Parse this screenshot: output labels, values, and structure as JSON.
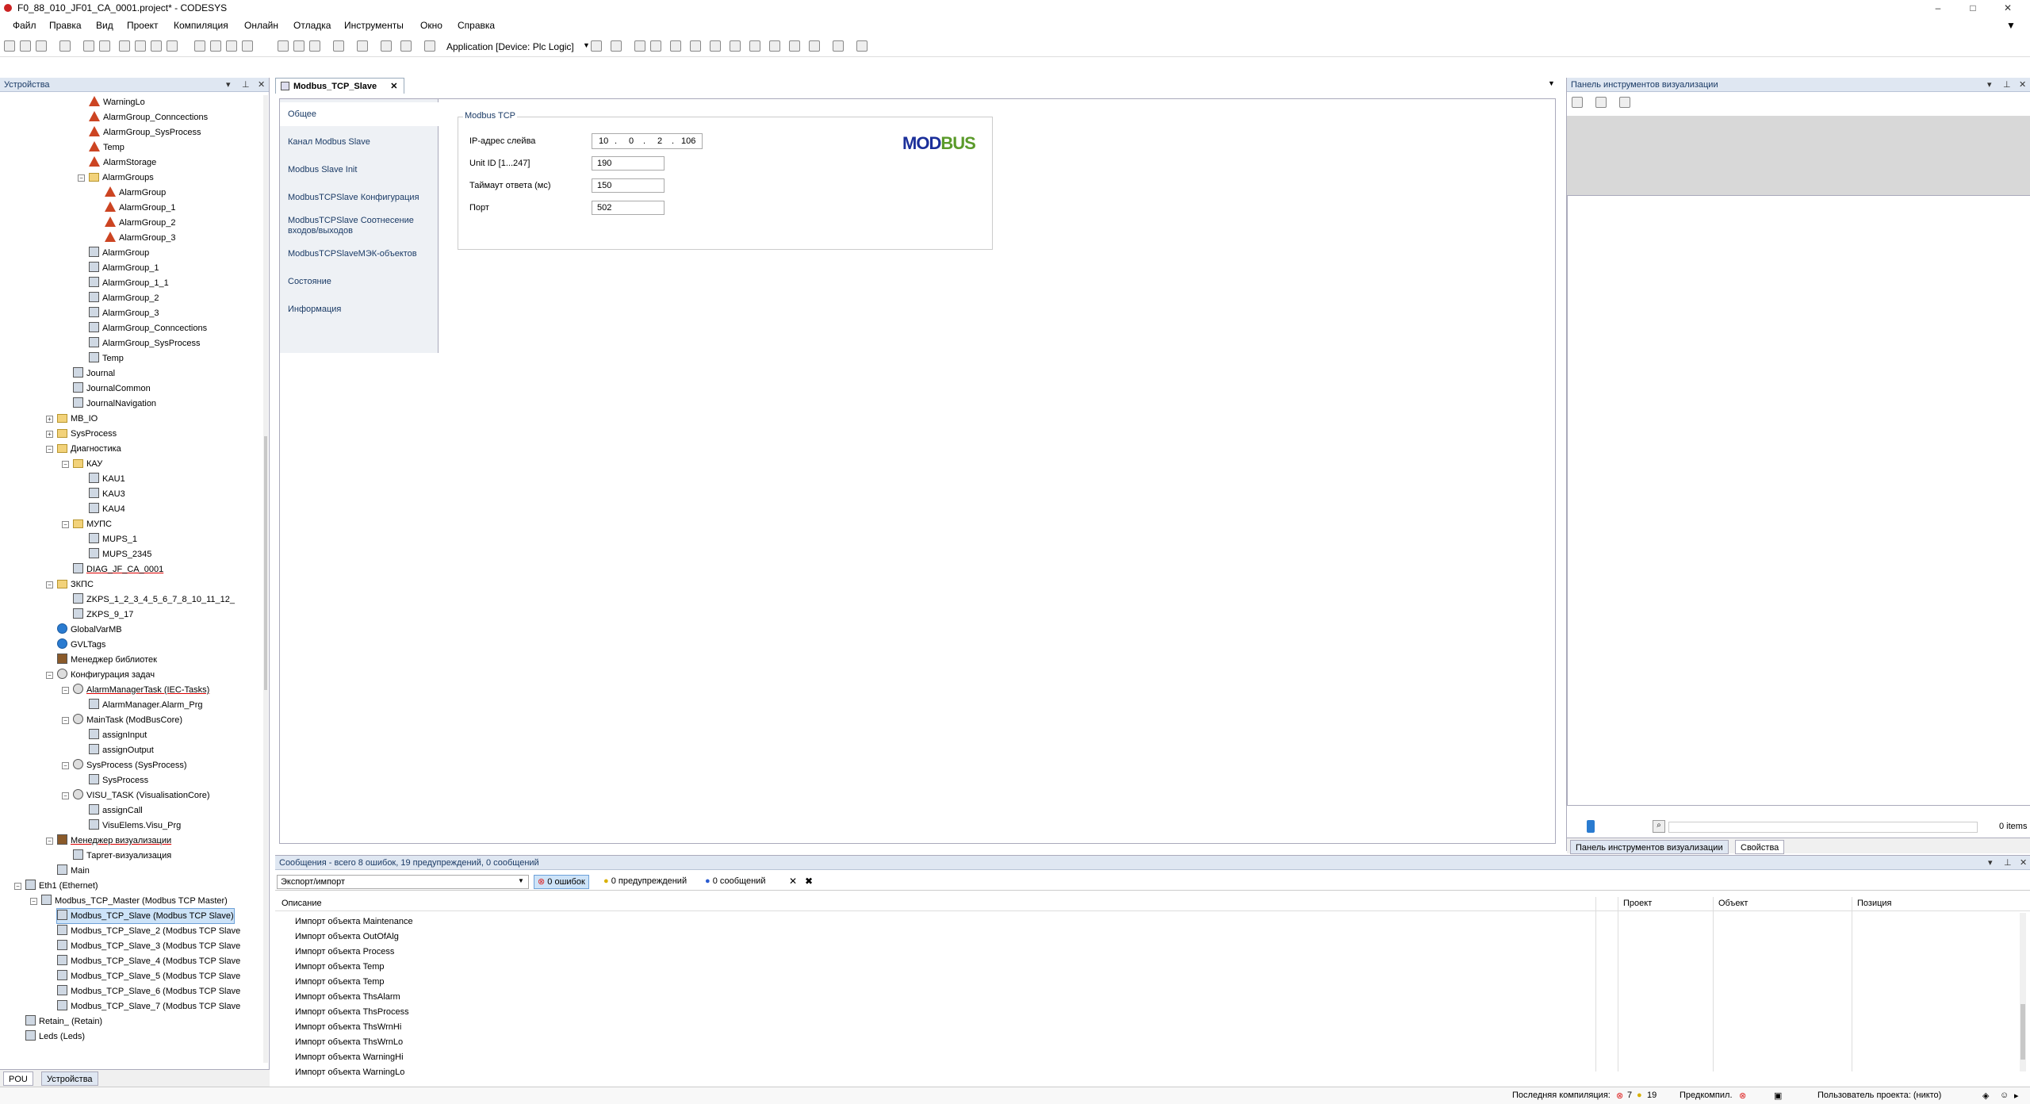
{
  "window": {
    "title": "F0_88_010_JF01_CA_0001.project* - CODESYS",
    "minimize": "–",
    "maximize": "□",
    "close": "✕"
  },
  "menu": [
    "Файл",
    "Правка",
    "Вид",
    "Проект",
    "Компиляция",
    "Онлайн",
    "Отладка",
    "Инструменты",
    "Окно",
    "Справка"
  ],
  "toolbar": {
    "application_label": "Application [Device: Plc Logic]"
  },
  "devices_panel": {
    "title": "Устройства",
    "tree": [
      {
        "label": "WarningLo",
        "depth": 6,
        "icon": "alarm"
      },
      {
        "label": "AlarmGroup_Conncections",
        "depth": 6,
        "icon": "alarm"
      },
      {
        "label": "AlarmGroup_SysProcess",
        "depth": 6,
        "icon": "alarm"
      },
      {
        "label": "Temp",
        "depth": 6,
        "icon": "alarm"
      },
      {
        "label": "AlarmStorage",
        "depth": 6,
        "icon": "alarm"
      },
      {
        "label": "AlarmGroups",
        "depth": 6,
        "icon": "folder",
        "expander": "−"
      },
      {
        "label": "AlarmGroup",
        "depth": 7,
        "icon": "alarm"
      },
      {
        "label": "AlarmGroup_1",
        "depth": 7,
        "icon": "alarm"
      },
      {
        "label": "AlarmGroup_2",
        "depth": 7,
        "icon": "alarm"
      },
      {
        "label": "AlarmGroup_3",
        "depth": 7,
        "icon": "alarm"
      },
      {
        "label": "AlarmGroup",
        "depth": 6,
        "icon": "dev"
      },
      {
        "label": "AlarmGroup_1",
        "depth": 6,
        "icon": "dev"
      },
      {
        "label": "AlarmGroup_1_1",
        "depth": 6,
        "icon": "dev"
      },
      {
        "label": "AlarmGroup_2",
        "depth": 6,
        "icon": "dev"
      },
      {
        "label": "AlarmGroup_3",
        "depth": 6,
        "icon": "dev"
      },
      {
        "label": "AlarmGroup_Conncections",
        "depth": 6,
        "icon": "dev"
      },
      {
        "label": "AlarmGroup_SysProcess",
        "depth": 6,
        "icon": "dev"
      },
      {
        "label": "Temp",
        "depth": 6,
        "icon": "dev"
      },
      {
        "label": "Journal",
        "depth": 5,
        "icon": "dev"
      },
      {
        "label": "JournalCommon",
        "depth": 5,
        "icon": "dev"
      },
      {
        "label": "JournalNavigation",
        "depth": 5,
        "icon": "dev"
      },
      {
        "label": "MB_IO",
        "depth": 4,
        "icon": "folder",
        "expander": "+"
      },
      {
        "label": "SysProcess",
        "depth": 4,
        "icon": "folder",
        "expander": "+"
      },
      {
        "label": "Диагностика",
        "depth": 4,
        "icon": "folder",
        "expander": "−"
      },
      {
        "label": "КАУ",
        "depth": 5,
        "icon": "folder",
        "expander": "−"
      },
      {
        "label": "KAU1",
        "depth": 6,
        "icon": "dev"
      },
      {
        "label": "KAU3",
        "depth": 6,
        "icon": "dev"
      },
      {
        "label": "KAU4",
        "depth": 6,
        "icon": "dev"
      },
      {
        "label": "МУПС",
        "depth": 5,
        "icon": "folder",
        "expander": "−"
      },
      {
        "label": "MUPS_1",
        "depth": 6,
        "icon": "dev"
      },
      {
        "label": "MUPS_2345",
        "depth": 6,
        "icon": "dev"
      },
      {
        "label": "DIAG_JF_CA_0001",
        "depth": 5,
        "icon": "dev",
        "underline": true
      },
      {
        "label": "ЗКПС",
        "depth": 4,
        "icon": "folder",
        "expander": "−"
      },
      {
        "label": "ZKPS_1_2_3_4_5_6_7_8_10_11_12_",
        "depth": 5,
        "icon": "dev"
      },
      {
        "label": "ZKPS_9_17",
        "depth": 5,
        "icon": "dev"
      },
      {
        "label": "GlobalVarMB",
        "depth": 4,
        "icon": "globe"
      },
      {
        "label": "GVLTags",
        "depth": 4,
        "icon": "globe"
      },
      {
        "label": "Менеджер библиотек",
        "depth": 4,
        "icon": "lib"
      },
      {
        "label": "Конфигурация задач",
        "depth": 4,
        "icon": "gear",
        "expander": "−"
      },
      {
        "label": "AlarmManagerTask (IEC-Tasks)",
        "depth": 5,
        "icon": "gear",
        "expander": "−",
        "underline": true
      },
      {
        "label": "AlarmManager.Alarm_Prg",
        "depth": 6,
        "icon": "dev"
      },
      {
        "label": "MainTask (ModBusCore)",
        "depth": 5,
        "icon": "gear",
        "expander": "−"
      },
      {
        "label": "assignInput",
        "depth": 6,
        "icon": "dev"
      },
      {
        "label": "assignOutput",
        "depth": 6,
        "icon": "dev"
      },
      {
        "label": "SysProcess (SysProcess)",
        "depth": 5,
        "icon": "gear",
        "expander": "−"
      },
      {
        "label": "SysProcess",
        "depth": 6,
        "icon": "dev"
      },
      {
        "label": "VISU_TASK (VisualisationCore)",
        "depth": 5,
        "icon": "gear",
        "expander": "−"
      },
      {
        "label": "assignCall",
        "depth": 6,
        "icon": "dev"
      },
      {
        "label": "VisuElems.Visu_Prg",
        "depth": 6,
        "icon": "dev"
      },
      {
        "label": "Менеджер визуализации",
        "depth": 4,
        "icon": "lib",
        "expander": "−",
        "underline": true
      },
      {
        "label": "Таргет-визуализация",
        "depth": 5,
        "icon": "dev"
      },
      {
        "label": "Main",
        "depth": 4,
        "icon": "dev"
      },
      {
        "label": "Eth1 (Ethernet)",
        "depth": 2,
        "icon": "dev",
        "expander": "−"
      },
      {
        "label": "Modbus_TCP_Master (Modbus TCP Master)",
        "depth": 3,
        "icon": "dev",
        "expander": "−"
      },
      {
        "label": "Modbus_TCP_Slave (Modbus TCP Slave)",
        "depth": 4,
        "icon": "dev",
        "selected": true
      },
      {
        "label": "Modbus_TCP_Slave_2 (Modbus TCP Slave",
        "depth": 4,
        "icon": "dev"
      },
      {
        "label": "Modbus_TCP_Slave_3 (Modbus TCP Slave",
        "depth": 4,
        "icon": "dev"
      },
      {
        "label": "Modbus_TCP_Slave_4 (Modbus TCP Slave",
        "depth": 4,
        "icon": "dev"
      },
      {
        "label": "Modbus_TCP_Slave_5 (Modbus TCP Slave",
        "depth": 4,
        "icon": "dev"
      },
      {
        "label": "Modbus_TCP_Slave_6 (Modbus TCP Slave",
        "depth": 4,
        "icon": "dev"
      },
      {
        "label": "Modbus_TCP_Slave_7 (Modbus TCP Slave",
        "depth": 4,
        "icon": "dev"
      },
      {
        "label": "Retain_ (Retain)",
        "depth": 2,
        "icon": "dev"
      },
      {
        "label": "Leds (Leds)",
        "depth": 2,
        "icon": "dev"
      }
    ],
    "bottom_tabs": [
      "POU",
      "Устройства"
    ]
  },
  "editor": {
    "tab_title": "Modbus_TCP_Slave",
    "side_tabs": [
      "Общее",
      "Канал Modbus Slave",
      "Modbus Slave Init",
      "ModbusTCPSlave Конфигурация",
      "ModbusTCPSlave Соотнесение входов/выходов",
      "ModbusTCPSlaveМЭК-объектов",
      "Состояние",
      "Информация"
    ],
    "group_title": "Modbus TCP",
    "ip_label": "IP-адрес слейва",
    "ip": [
      "10",
      "0",
      "2",
      "106"
    ],
    "unit_id_label": "Unit ID [1...247]",
    "unit_id": "190",
    "timeout_label": "Таймаут ответа (мс)",
    "timeout": "150",
    "port_label": "Порт",
    "port": "502",
    "logo": {
      "part1": "MOD",
      "part2": "BUS",
      "color1": "#1b2f9a",
      "color2": "#5a9a2a"
    }
  },
  "visu_panel": {
    "title": "Панель инструментов визуализации",
    "items_count": "0 items",
    "bottom_tabs": [
      "Панель инструментов визуализации",
      "Свойства"
    ]
  },
  "messages": {
    "title": "Сообщения - всего 8 ошибок, 19 предупреждений, 0 сообщений",
    "filter_value": "Экспорт/импорт",
    "errors_btn": "0 ошибок",
    "warnings_btn": "0 предупреждений",
    "infos_btn": "0 сообщений",
    "columns": [
      "Описание",
      "Проект",
      "Объект",
      "Позиция"
    ],
    "rows": [
      "Импорт объекта Maintenance",
      "Импорт объекта OutOfAlg",
      "Импорт объекта Process",
      "Импорт объекта Temp",
      "Импорт объекта Temp",
      "Импорт объекта ThsAlarm",
      "Импорт объекта ThsProcess",
      "Импорт объекта ThsWrnHi",
      "Импорт объекта ThsWrnLo",
      "Импорт объекта WarningHi",
      "Импорт объекта WarningLo"
    ]
  },
  "status": {
    "last_compile": "Последняя компиляция:",
    "errors": "7",
    "warnings": "19",
    "precompile": "Предкомпил.",
    "user": "Пользователь проекта: (никто)"
  }
}
